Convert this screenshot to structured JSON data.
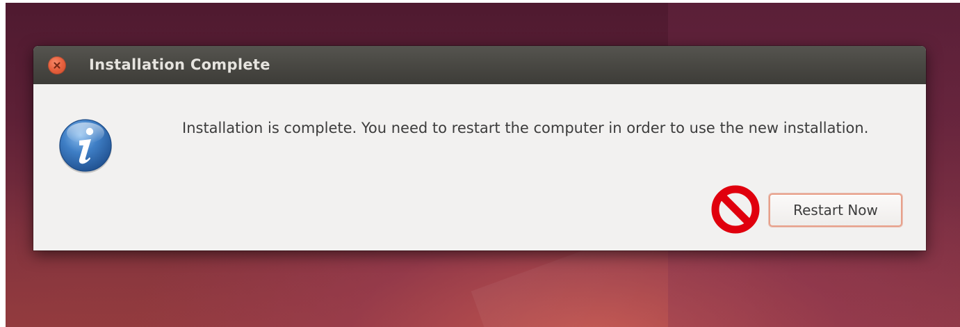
{
  "window": {
    "title": "Installation Complete"
  },
  "dialog": {
    "message": "Installation is complete. You need to restart the computer in order to use the new installation.",
    "restart_label": "Restart Now"
  },
  "icons": {
    "close": "close-icon",
    "info": "info-icon",
    "prohibited": "no-sign-icon"
  },
  "colors": {
    "close_button": "#e9623f",
    "titlebar": "#4a4944",
    "dialog_bg": "#f2f1f0",
    "info_blue": "#2f6db5",
    "no_sign_red": "#e0000d",
    "button_focus": "#e8a08a"
  }
}
